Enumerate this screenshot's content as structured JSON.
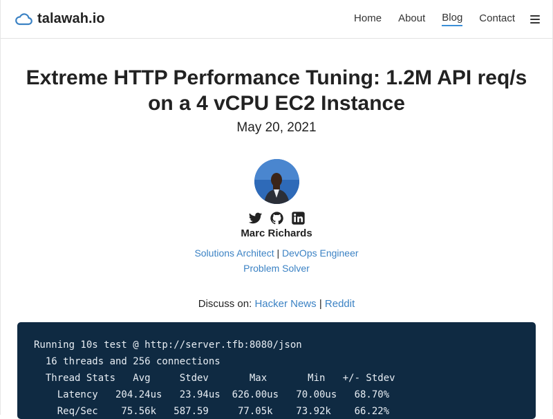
{
  "header": {
    "brand": "talawah.io",
    "nav": [
      {
        "label": "Home"
      },
      {
        "label": "About"
      },
      {
        "label": "Blog",
        "active": true
      },
      {
        "label": "Contact"
      }
    ]
  },
  "post": {
    "title": "Extreme HTTP Performance Tuning: 1.2M API req/s on a 4 vCPU EC2 Instance",
    "date": "May 20, 2021"
  },
  "author": {
    "name": "Marc Richards",
    "roles": {
      "role1": "Solutions Architect",
      "separator": "|",
      "role2": "DevOps Engineer",
      "role3": "Problem Solver"
    },
    "social": [
      "twitter-icon",
      "github-icon",
      "linkedin-icon"
    ]
  },
  "discuss": {
    "label": "Discuss on:",
    "link1": "Hacker News",
    "separator": "|",
    "link2": "Reddit"
  },
  "code": {
    "lines": [
      "Running 10s test @ http://server.tfb:8080/json",
      "  16 threads and 256 connections",
      "  Thread Stats   Avg     Stdev       Max       Min   +/- Stdev",
      "    Latency   204.24us   23.94us  626.00us   70.00us   68.70%",
      "    Req/Sec    75.56k   587.59     77.05k    73.92k    66.22%"
    ]
  },
  "colors": {
    "link": "#3b82c4",
    "code_bg": "#0f2a42",
    "nav_active_underline": "#3a8fd8"
  }
}
